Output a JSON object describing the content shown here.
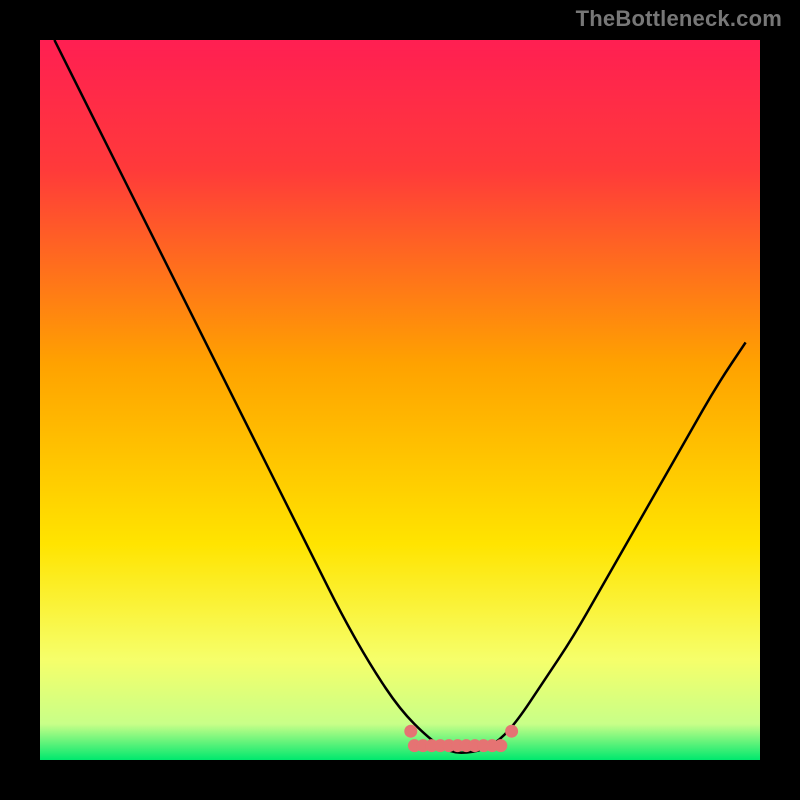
{
  "attribution": "TheBottleneck.com",
  "colors": {
    "gradient_stops": [
      {
        "offset": 0.0,
        "color": "#ff1f52"
      },
      {
        "offset": 0.18,
        "color": "#ff3a3a"
      },
      {
        "offset": 0.45,
        "color": "#ffa200"
      },
      {
        "offset": 0.7,
        "color": "#ffe400"
      },
      {
        "offset": 0.86,
        "color": "#f6ff6a"
      },
      {
        "offset": 0.95,
        "color": "#c8ff88"
      },
      {
        "offset": 1.0,
        "color": "#00e86e"
      }
    ],
    "curve": "#000000",
    "valley_marker": "#e57373"
  },
  "chart_data": {
    "type": "line",
    "title": "",
    "xlabel": "",
    "ylabel": "",
    "xlim": [
      0,
      100
    ],
    "ylim": [
      0,
      100
    ],
    "grid": false,
    "legend": false,
    "series": [
      {
        "name": "bottleneck-curve",
        "x": [
          2,
          6,
          10,
          14,
          18,
          22,
          26,
          30,
          34,
          38,
          42,
          46,
          50,
          54,
          57,
          60,
          63,
          66,
          70,
          74,
          78,
          82,
          86,
          90,
          94,
          98
        ],
        "y": [
          100,
          92,
          84,
          76,
          68,
          60,
          52,
          44,
          36,
          28,
          20,
          13,
          7,
          3,
          1,
          1,
          2,
          5,
          11,
          17,
          24,
          31,
          38,
          45,
          52,
          58
        ]
      }
    ],
    "annotations": {
      "valley_marker_x_range": [
        52,
        65
      ],
      "valley_marker_y": 2
    }
  }
}
